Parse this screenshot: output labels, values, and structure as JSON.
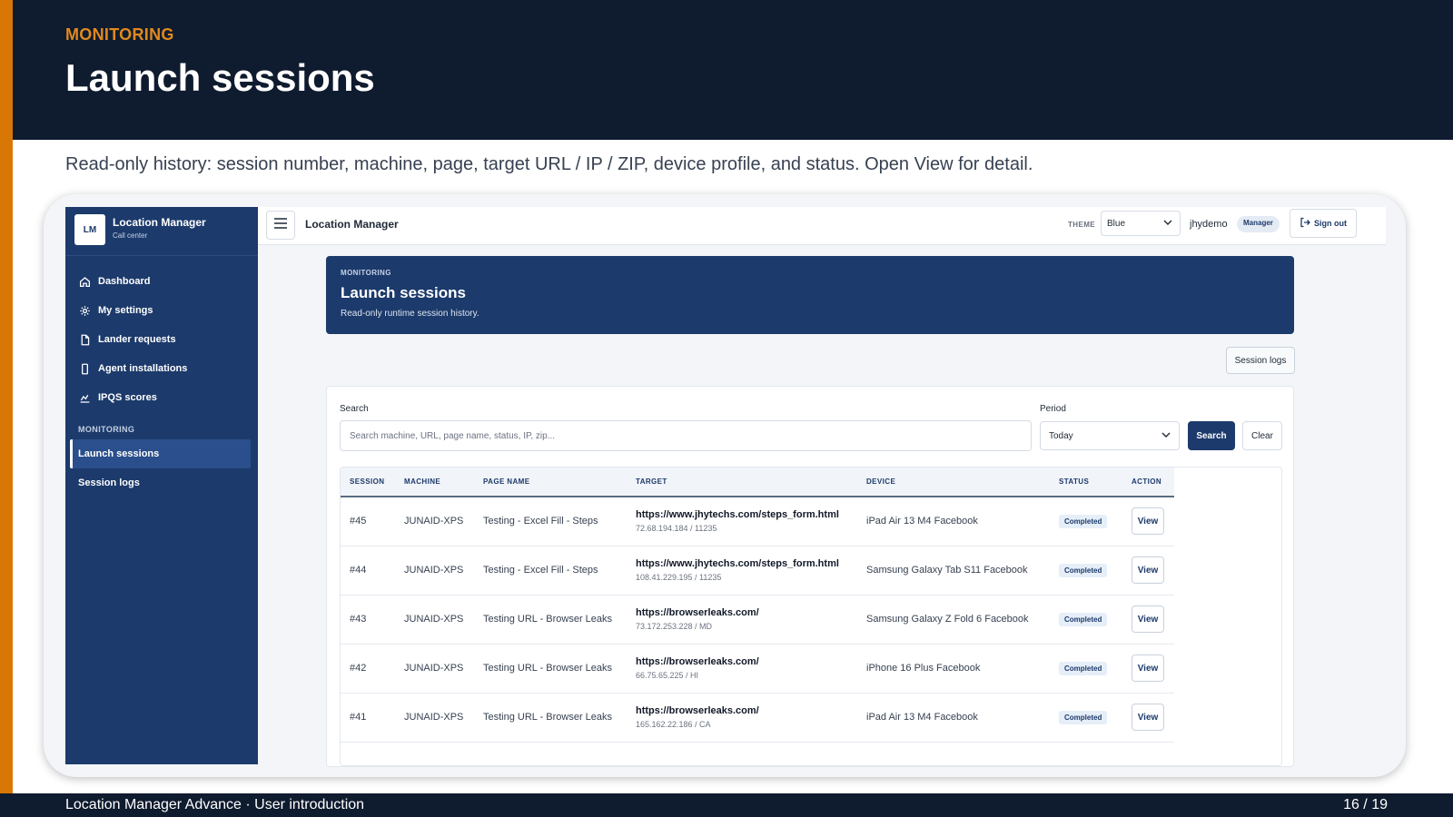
{
  "slide": {
    "eyebrow": "MONITORING",
    "title": "Launch sessions",
    "description": "Read-only history: session number, machine, page, target URL / IP / ZIP, device profile, and status. Open View for detail.",
    "footer_left": "Location Manager Advance  · User introduction",
    "footer_right": "16  /  19",
    "accent_color": "#d97706",
    "header_color": "#0f1b2e"
  },
  "app": {
    "brand": {
      "logo": "LM",
      "name": "Location Manager",
      "subtitle": "Call center"
    },
    "nav": [
      {
        "label": "Dashboard",
        "icon": "home-icon"
      },
      {
        "label": "My settings",
        "icon": "gear-icon"
      },
      {
        "label": "Lander requests",
        "icon": "file-icon"
      },
      {
        "label": "Agent installations",
        "icon": "device-icon"
      },
      {
        "label": "IPQS scores",
        "icon": "chart-icon"
      }
    ],
    "nav_section": "MONITORING",
    "nav_monitoring": [
      {
        "label": "Launch sessions",
        "active": true
      },
      {
        "label": "Session logs",
        "active": false
      }
    ],
    "topbar": {
      "title": "Location Manager",
      "theme_label": "THEME",
      "theme_value": "Blue",
      "user": "jhydemo",
      "role": "Manager",
      "signout": "Sign out"
    },
    "hero": {
      "eyebrow": "MONITORING",
      "title": "Launch sessions",
      "subtitle": "Read-only runtime session history."
    },
    "session_logs_button": "Session logs",
    "filters": {
      "search_label": "Search",
      "search_placeholder": "Search machine, URL, page name, status, IP, zip...",
      "period_label": "Period",
      "period_value": "Today",
      "search_button": "Search",
      "clear_button": "Clear"
    },
    "table": {
      "columns": [
        "SESSION",
        "MACHINE",
        "PAGE NAME",
        "TARGET",
        "DEVICE",
        "STATUS",
        "ACTION"
      ],
      "rows": [
        {
          "session": "#45",
          "machine": "JUNAID-XPS",
          "page": "Testing - Excel Fill - Steps",
          "url": "https://www.jhytechs.com/steps_form.html",
          "ip": "72.68.194.184 / 11235",
          "device": "iPad Air 13 M4 Facebook",
          "status": "Completed",
          "action": "View"
        },
        {
          "session": "#44",
          "machine": "JUNAID-XPS",
          "page": "Testing - Excel Fill - Steps",
          "url": "https://www.jhytechs.com/steps_form.html",
          "ip": "108.41.229.195 / 11235",
          "device": "Samsung Galaxy Tab S11 Facebook",
          "status": "Completed",
          "action": "View"
        },
        {
          "session": "#43",
          "machine": "JUNAID-XPS",
          "page": "Testing URL - Browser Leaks",
          "url": "https://browserleaks.com/",
          "ip": "73.172.253.228 / MD",
          "device": "Samsung Galaxy Z Fold 6 Facebook",
          "status": "Completed",
          "action": "View"
        },
        {
          "session": "#42",
          "machine": "JUNAID-XPS",
          "page": "Testing URL - Browser Leaks",
          "url": "https://browserleaks.com/",
          "ip": "66.75.65.225 / HI",
          "device": "iPhone 16 Plus Facebook",
          "status": "Completed",
          "action": "View"
        },
        {
          "session": "#41",
          "machine": "JUNAID-XPS",
          "page": "Testing URL - Browser Leaks",
          "url": "https://browserleaks.com/",
          "ip": "165.162.22.186 / CA",
          "device": "iPad Air 13 M4 Facebook",
          "status": "Completed",
          "action": "View"
        }
      ]
    },
    "colors": {
      "sidebar": "#1c3a6b",
      "primary": "#1c3a6b",
      "status_bg": "#e6eef8"
    }
  }
}
